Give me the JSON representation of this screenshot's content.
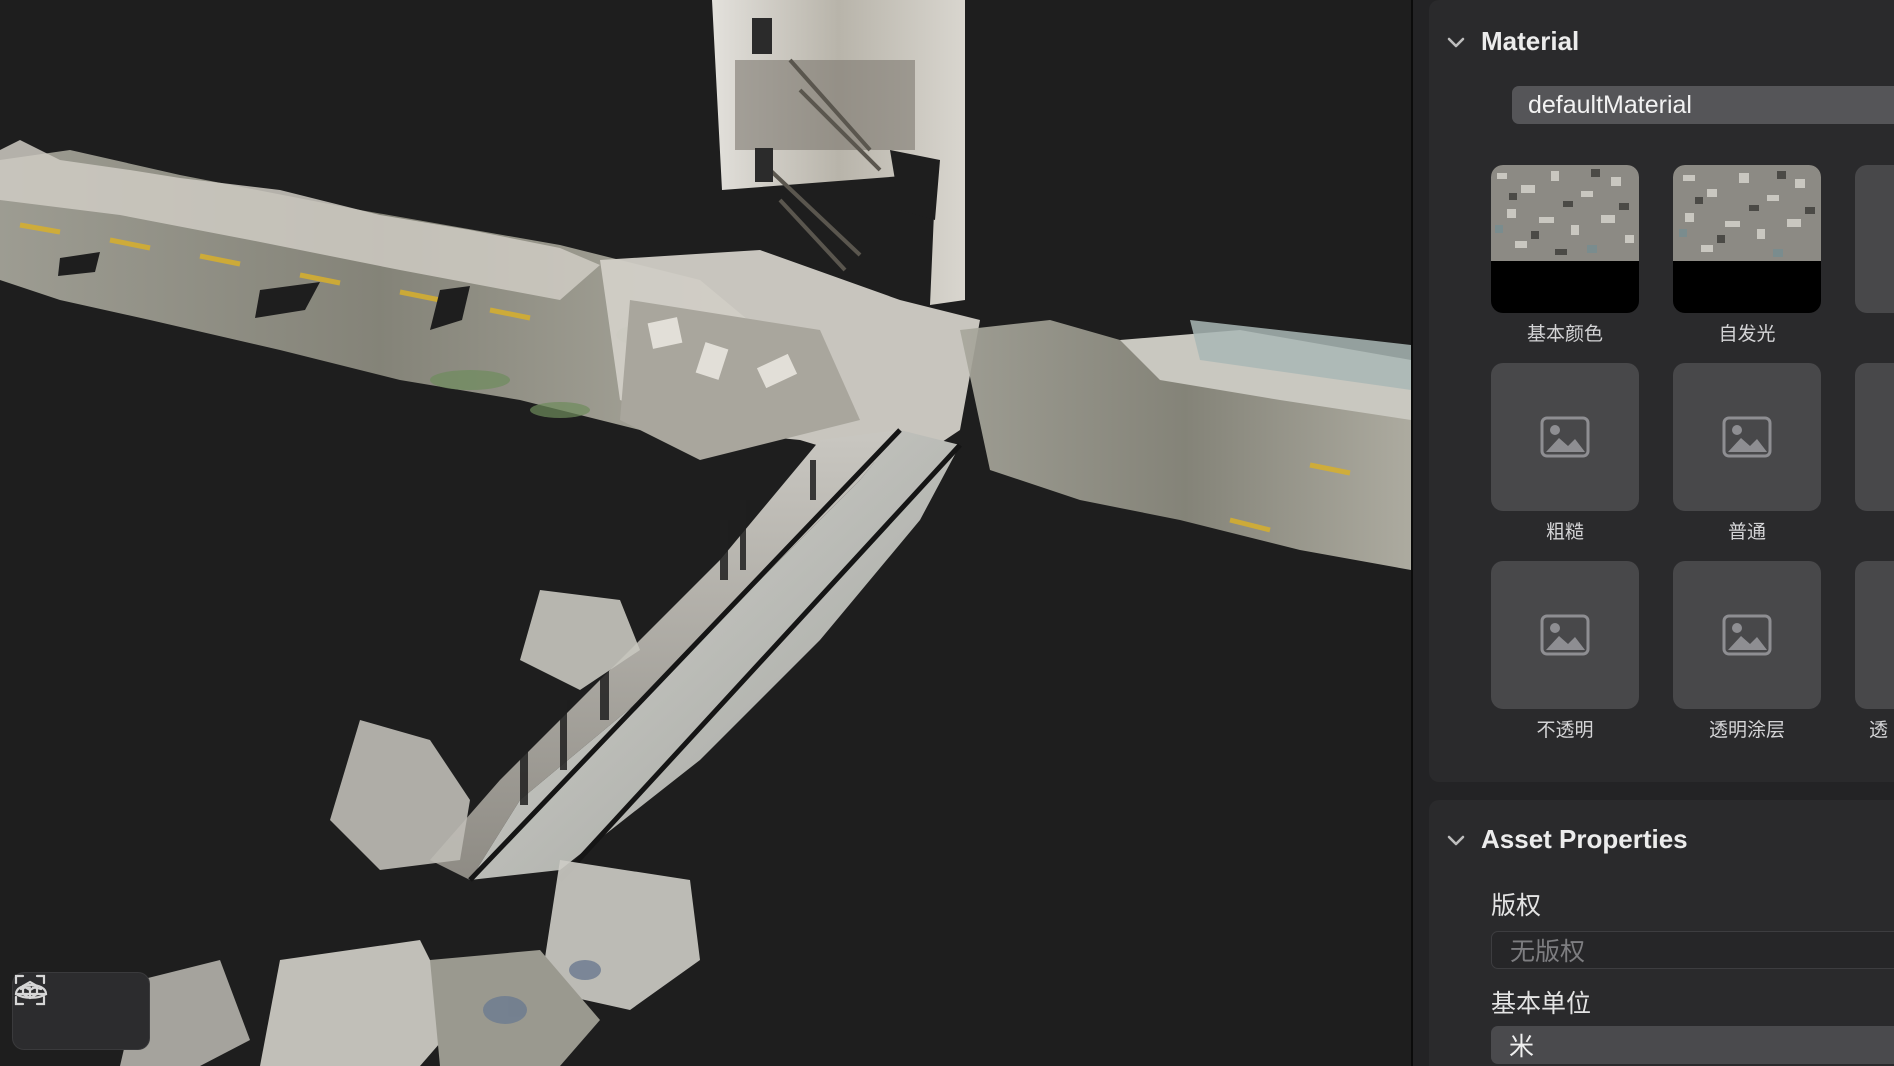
{
  "material_section": {
    "title": "Material",
    "material_name": "defaultMaterial",
    "slots": [
      {
        "label": "基本颜色",
        "kind": "texture"
      },
      {
        "label": "自发光",
        "kind": "texture"
      },
      {
        "label": "粗糙",
        "kind": "empty"
      },
      {
        "label": "普通",
        "kind": "empty"
      },
      {
        "label": "不透明",
        "kind": "empty"
      },
      {
        "label": "透明涂层",
        "kind": "empty"
      },
      {
        "label": "透",
        "kind": "empty"
      }
    ]
  },
  "asset_section": {
    "title": "Asset Properties",
    "copyright_label": "版权",
    "copyright_placeholder": "无版权",
    "unit_label": "基本单位",
    "unit_value": "米"
  },
  "toolbar": {
    "icons": [
      "scene-frame-icon",
      "environment-dome-icon"
    ]
  },
  "colors": {
    "viewport_bg": "#1e1e1e",
    "panel_bg": "#2a2a2c",
    "field_bg": "#555558"
  }
}
